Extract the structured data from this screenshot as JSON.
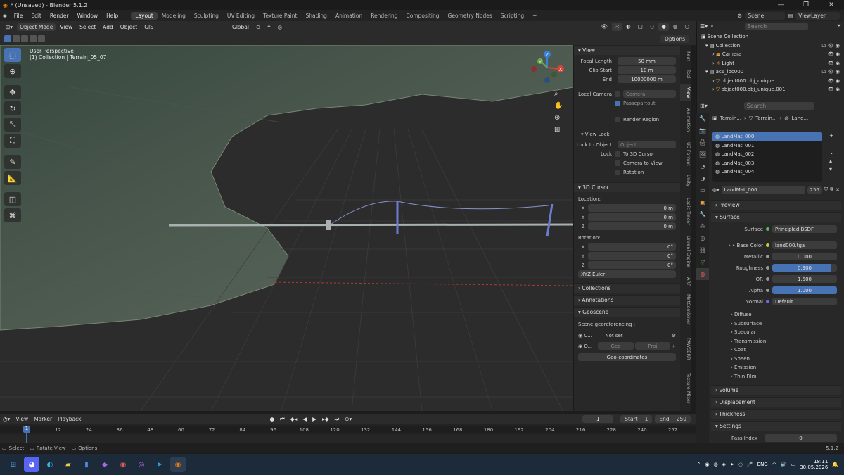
{
  "window": {
    "title": "* (Unsaved) - Blender 5.1.2",
    "min": "—",
    "max": "❐",
    "close": "✕"
  },
  "menus": [
    "File",
    "Edit",
    "Render",
    "Window",
    "Help"
  ],
  "workspaces": [
    "Layout",
    "Modeling",
    "Sculpting",
    "UV Editing",
    "Texture Paint",
    "Shading",
    "Animation",
    "Rendering",
    "Compositing",
    "Geometry Nodes",
    "Scripting"
  ],
  "scene": {
    "label": "Scene",
    "viewlayer": "ViewLayer"
  },
  "header": {
    "mode": "Object Mode",
    "view": "View",
    "select": "Select",
    "add": "Add",
    "object": "Object",
    "gis": "GIS",
    "orientation": "Global",
    "options": "Options"
  },
  "viewport": {
    "perspective": "User Perspective",
    "collection": "(1) Collection | Terrain_05_07",
    "axes": {
      "x": "X",
      "y": "Y",
      "z": "Z"
    }
  },
  "npanel": {
    "view": {
      "title": "View",
      "focal_label": "Focal Length",
      "focal": "50 mm",
      "clip_start_label": "Clip Start",
      "clip_start": "10 m",
      "end_label": "End",
      "end": "10000000 m",
      "local_camera_label": "Local Camera",
      "camera_placeholder": "Camera",
      "passepartout": "Passepartout",
      "render_region": "Render Region"
    },
    "viewlock": {
      "title": "View Lock",
      "lock_to_object": "Lock to Object",
      "object_placeholder": "Object",
      "lock": "Lock",
      "to_3d_cursor": "To 3D Cursor",
      "camera_to_view": "Camera to View",
      "rotation": "Rotation"
    },
    "cursor": {
      "title": "3D Cursor",
      "location": "Location:",
      "x": "0 m",
      "y": "0 m",
      "z": "0 m",
      "rotation_label": "Rotation:",
      "rx": "0°",
      "ry": "0°",
      "rz": "0°",
      "mode": "XYZ Euler",
      "xl": "X",
      "yl": "Y",
      "zl": "Z"
    },
    "collections": "Collections",
    "annotations": "Annotations",
    "geoscene": {
      "title": "Geoscene",
      "georef": "Scene georeferencing :",
      "c": "C...",
      "notset": "Not set",
      "o": "O...",
      "geo": "Geo",
      "proj": "Proj",
      "geocoords": "Geo-coordinates"
    }
  },
  "ntabs": [
    "Item",
    "Tool",
    "View",
    "Animation",
    "UE Format",
    "Unity",
    "Logic Tracer",
    "Unreal Engine",
    "ARP",
    "MatCombiner",
    "PAWSBRR",
    "Texture Mixer"
  ],
  "outliner": {
    "search": "Search",
    "root": "Scene Collection",
    "collection": "Collection",
    "camera": "Camera",
    "light": "Light",
    "ac6": "ac6_loc000",
    "obj1": "object000.obj_unique",
    "obj2": "object000.obj_unique.001"
  },
  "props": {
    "search": "Search",
    "crumb1": "Terrain...",
    "crumb2": "Terrain...",
    "crumb3": "Land...",
    "materials": [
      "LandMat_000",
      "LandMat_001",
      "LandMat_002",
      "LandMat_003",
      "LandMat_004"
    ],
    "material_name": "LandMat_000",
    "users": "256",
    "preview": "Preview",
    "surface": "Surface",
    "surface_label": "Surface",
    "bsdf": "Principled BSDF",
    "base_color_label": "Base Color",
    "base_color": "land000.tga",
    "metallic_label": "Metallic",
    "metallic": "0.000",
    "roughness_label": "Roughness",
    "roughness": "0.900",
    "roughness_frac": 0.9,
    "ior_label": "IOR",
    "ior": "1.500",
    "alpha_label": "Alpha",
    "alpha": "1.000",
    "normal_label": "Normal",
    "normal": "Default",
    "subs": [
      "Diffuse",
      "Subsurface",
      "Specular",
      "Transmission",
      "Coat",
      "Sheen",
      "Emission",
      "Thin Film"
    ],
    "volume": "Volume",
    "displacement": "Displacement",
    "thickness": "Thickness",
    "settings": "Settings",
    "pass_index_label": "Pass Index",
    "pass_index": "0"
  },
  "timeline": {
    "view": "View",
    "marker": "Marker",
    "playback": "Playback",
    "frame": "1",
    "start_label": "Start",
    "start": "1",
    "end_label": "End",
    "end": "250",
    "ticks": [
      "1",
      "12",
      "24",
      "36",
      "48",
      "60",
      "72",
      "84",
      "96",
      "108",
      "120",
      "132",
      "144",
      "156",
      "168",
      "180",
      "192",
      "204",
      "216",
      "228",
      "240",
      "252"
    ]
  },
  "status": {
    "select": "Select",
    "rotate": "Rotate View",
    "options": "Options",
    "version": "5.1.2"
  },
  "taskbar": {
    "lang": "ENG",
    "time": "18:11",
    "date": "30.05.2026"
  },
  "colors": {
    "accent": "#4772b3",
    "x_axis": "#d8443a",
    "y_axis": "#6aa84f",
    "z_axis": "#3a7fd8"
  }
}
